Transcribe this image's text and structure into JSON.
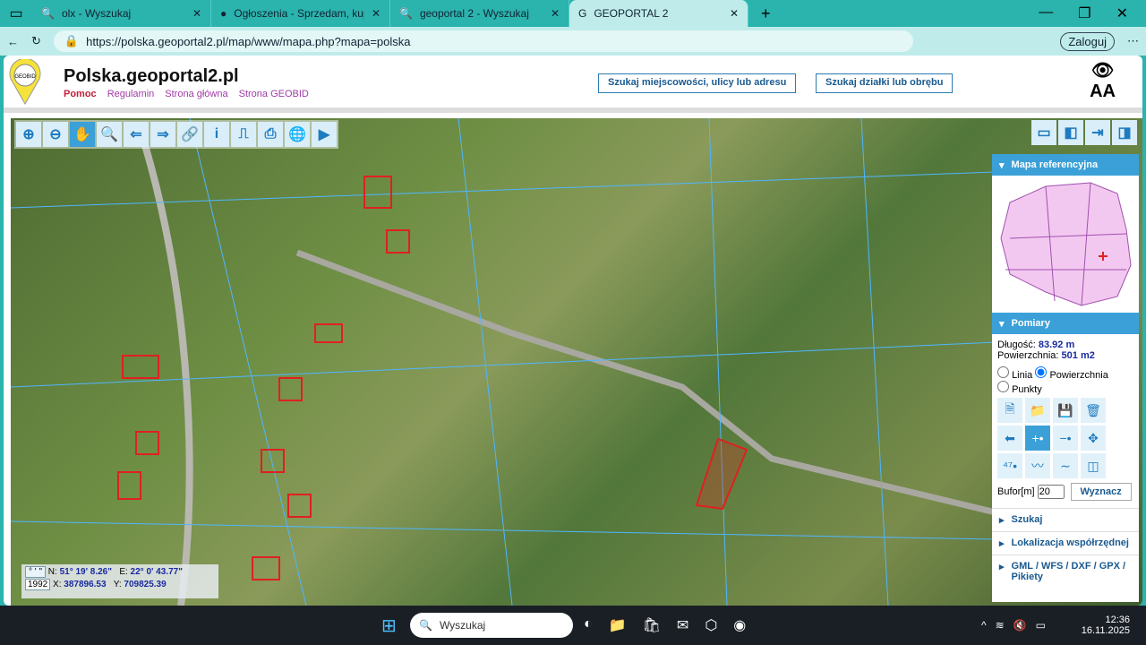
{
  "browser": {
    "tabs": [
      {
        "title": "olx - Wyszukaj"
      },
      {
        "title": "Ogłoszenia - Sprzedam, kupię na"
      },
      {
        "title": "geoportal 2 - Wyszukaj"
      },
      {
        "title": "GEOPORTAL 2",
        "active": true
      }
    ],
    "url": "https://polska.geoportal2.pl/map/www/mapa.php?mapa=polska",
    "login": "Zaloguj"
  },
  "header": {
    "logo_text": "GEOBID",
    "title": "Polska.geoportal2.pl",
    "links": [
      "Pomoc",
      "Regulamin",
      "Strona główna",
      "Strona GEOBID"
    ],
    "search_address": "Szukaj miejscowości, ulicy lub adresu",
    "search_parcel": "Szukaj działki lub obrębu",
    "font_size_label": "AA"
  },
  "panel": {
    "ref_map": "Mapa referencyjna",
    "pomiary": "Pomiary",
    "length_label": "Długość:",
    "length": "83.92 m",
    "area_label": "Powierzchnia:",
    "area": "501 m2",
    "modes": [
      "Linia",
      "Powierzchnia",
      "Punkty"
    ],
    "selected_mode": "Powierzchnia",
    "buffer_label": "Bufor[m]",
    "buffer_value": "20",
    "compute": "Wyznacz",
    "sections": [
      "Szukaj",
      "Lokalizacja współrzędnej",
      "GML / WFS / DXF / GPX / Pikiety"
    ]
  },
  "coords": {
    "fmt": "° ' \"",
    "system": "1992",
    "n_label": "N:",
    "n": "51° 19' 8.26\"",
    "e_label": "E:",
    "e": "22° 0' 43.77\"",
    "x_label": "X:",
    "x": "387896.53",
    "y_label": "Y:",
    "y": "709825.39"
  },
  "taskbar": {
    "search": "Wyszukaj",
    "time": "12:36",
    "date": "16.11.2025"
  },
  "colors": {
    "accent": "#3ba0d8",
    "parcel": "#e02020"
  }
}
